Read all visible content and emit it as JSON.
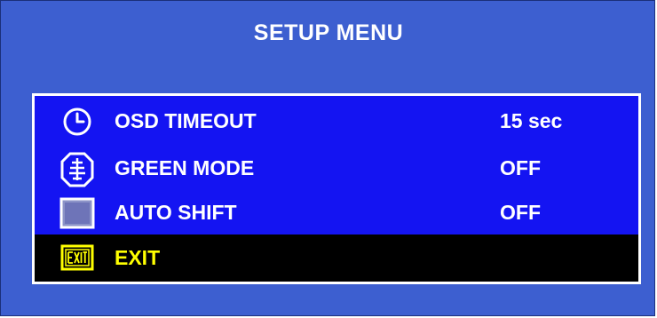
{
  "menu": {
    "title": "SETUP MENU",
    "items": [
      {
        "icon": "clock-icon",
        "label": "OSD TIMEOUT",
        "value": "15 sec"
      },
      {
        "icon": "green-mode-icon",
        "label": "GREEN MODE",
        "value": "OFF"
      },
      {
        "icon": "auto-shift-icon",
        "label": "AUTO SHIFT",
        "value": "OFF"
      },
      {
        "icon": "exit-icon",
        "label": "EXIT",
        "value": "",
        "selected": true
      }
    ]
  },
  "colors": {
    "background": "#3d5fd0",
    "menu_box": "#1414f2",
    "selected_row": "#000000",
    "selected_text": "#ffff00",
    "text": "#ffffff"
  }
}
